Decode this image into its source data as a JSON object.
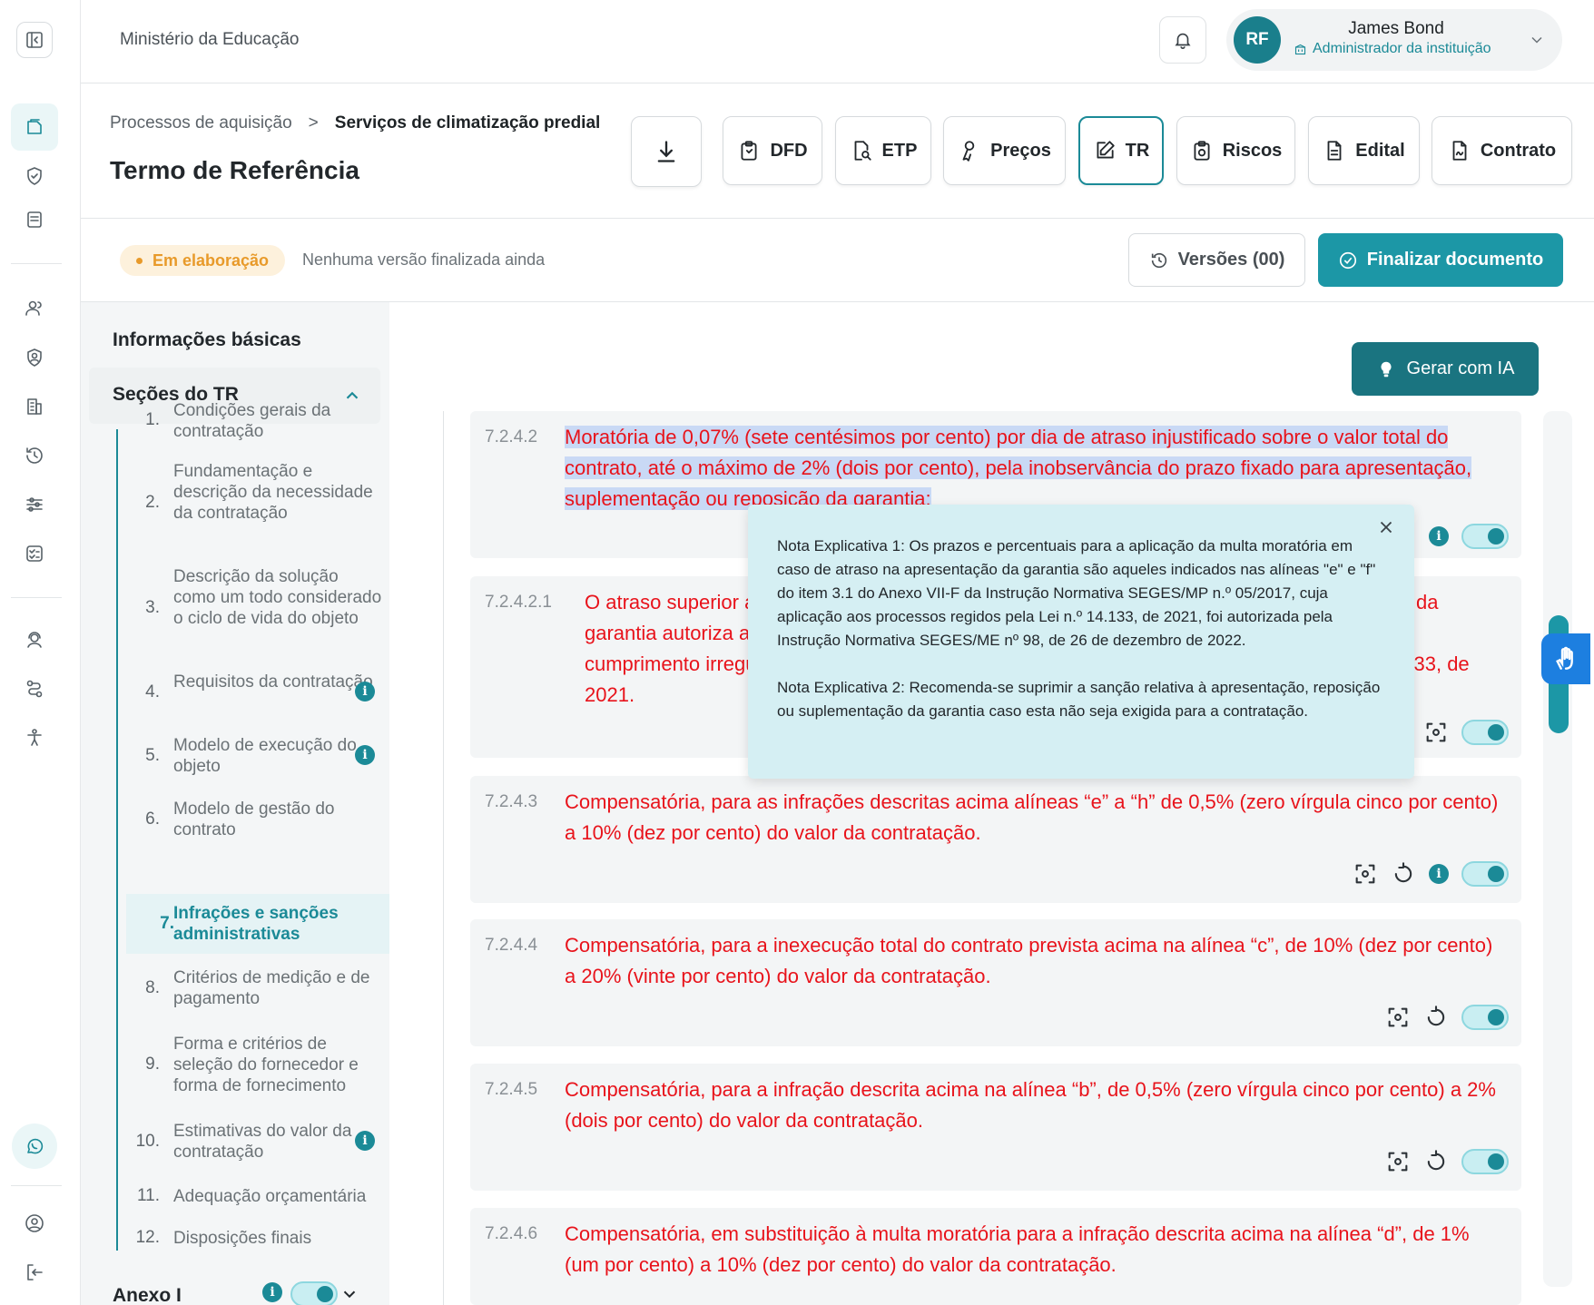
{
  "topbar": {
    "ministry": "Ministério da Educação",
    "user_initials": "RF",
    "user_name": "James Bond",
    "user_role": "Administrador da instituição"
  },
  "breadcrumb": {
    "parent": "Processos de aquisição",
    "separator": ">",
    "current": "Serviços de climatização predial"
  },
  "page_title": "Termo de Referência",
  "tabs": [
    {
      "label": "DFD",
      "icon": "clipboard-icon"
    },
    {
      "label": "ETP",
      "icon": "document-search-icon"
    },
    {
      "label": "Preços",
      "icon": "price-tag-icon"
    },
    {
      "label": "TR",
      "icon": "edit-icon",
      "active": true
    },
    {
      "label": "Riscos",
      "icon": "clipboard-alert-icon"
    },
    {
      "label": "Edital",
      "icon": "file-text-icon"
    },
    {
      "label": "Contrato",
      "icon": "file-signature-icon"
    }
  ],
  "status": {
    "badge": "Em elaboração",
    "text": "Nenhuma versão finalizada ainda",
    "versions_label": "Versões (00)",
    "finalize_label": "Finalizar documento"
  },
  "sidebar": {
    "basic_info": "Informações básicas",
    "sections_title": "Seções do TR",
    "items": [
      {
        "num": "1.",
        "label": "Condições gerais da contratação"
      },
      {
        "num": "2.",
        "label": "Fundamentação e descrição da necessidade da contratação"
      },
      {
        "num": "3.",
        "label": "Descrição da solução como um todo considerado o ciclo de vida do objeto"
      },
      {
        "num": "4.",
        "label": "Requisitos da contratação",
        "info": true
      },
      {
        "num": "5.",
        "label": "Modelo de execução do objeto",
        "info": true
      },
      {
        "num": "6.",
        "label": "Modelo de gestão do contrato"
      },
      {
        "num": "7.",
        "label": "Infrações e sanções administrativas",
        "active": true
      },
      {
        "num": "8.",
        "label": "Critérios de medição e de pagamento"
      },
      {
        "num": "9.",
        "label": "Forma e critérios de seleção do fornecedor e forma de fornecimento"
      },
      {
        "num": "10.",
        "label": "Estimativas do valor da contratação",
        "info": true
      },
      {
        "num": "11.",
        "label": "Adequação orçamentária"
      },
      {
        "num": "12.",
        "label": "Disposições finais"
      }
    ],
    "annex": "Anexo I",
    "info_glyph": "i"
  },
  "main": {
    "ia_label": "Gerar com IA",
    "clauses": [
      {
        "num": "7.2.4.2",
        "text": "Moratória de 0,07% (sete centésimos por cento) por dia de atraso injustificado sobre o valor total do contrato, até o máximo de 2% (dois por cento), pela inobservância do prazo fixado para apresentação, suplementação ou reposição da garantia;"
      },
      {
        "num": "7.2.4.2.1",
        "text": "O atraso superior a 25 (vinte e cinco) dias para a apresentação, suplementação ou reposição da garantia autoriza a Administração a promover a extinção do contrato por descumprimento ou cumprimento irregular de suas cláusulas, conforme dispõe o inciso I do art. 137 da Lei n. 14.133, de 2021."
      },
      {
        "num": "7.2.4.3",
        "text": "Compensatória, para as infrações descritas acima alíneas “e” a “h” de 0,5% (zero vírgula cinco por cento) a 10% (dez por cento) do valor da contratação."
      },
      {
        "num": "7.2.4.4",
        "text": "Compensatória, para a inexecução total do contrato prevista acima na alínea “c”, de 10% (dez por cento) a 20% (vinte por cento) do valor da contratação."
      },
      {
        "num": "7.2.4.5",
        "text": "Compensatória, para a infração descrita acima na alínea “b”, de 0,5% (zero vírgula cinco por cento) a 2% (dois por cento) do valor da contratação."
      },
      {
        "num": "7.2.4.6",
        "text": "Compensatória, em substituição à multa moratória para a infração descrita acima na alínea “d”, de 1% (um por cento) a 10% (dez por cento) do valor da contratação."
      }
    ],
    "popover": {
      "note1": "Nota Explicativa 1: Os prazos e percentuais para a aplicação da multa moratória em caso de atraso na apresentação da garantia são aqueles indicados nas alíneas \"e\" e \"f\" do item 3.1 do Anexo VII-F da Instrução Normativa SEGES/MP n.º 05/2017, cuja aplicação aos processos regidos pela Lei n.º 14.133, de 2021, foi autorizada pela Instrução Normativa SEGES/ME nº 98, de 26 de dezembro de 2022.",
      "note2": "Nota Explicativa 2: Recomenda-se suprimir a sanção relativa à apresentação, reposição ou suplementação da garantia caso esta não seja exigida para a contratação."
    }
  },
  "colors": {
    "accent": "#1b8a97",
    "clause_text": "#e8131b",
    "badge_bg": "#fdf1dc",
    "badge_text": "#e89a2a",
    "finalize": "#1c97a6"
  }
}
